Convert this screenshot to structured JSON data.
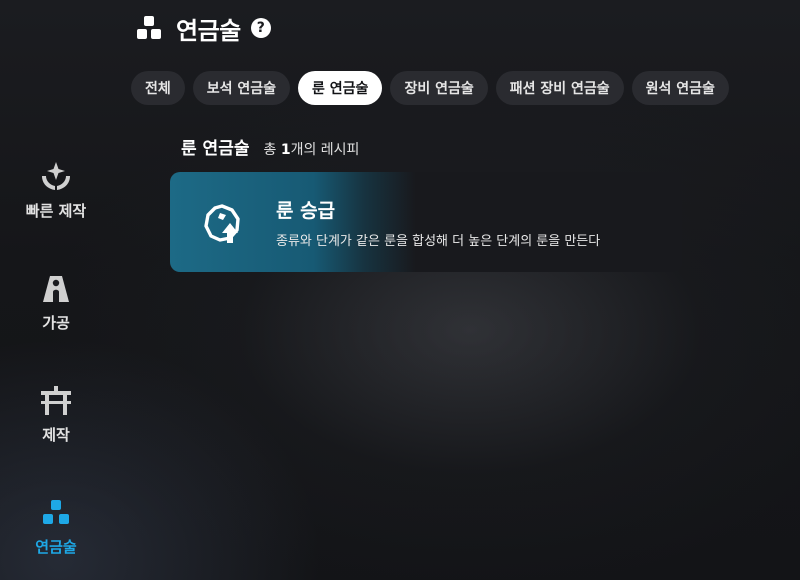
{
  "header": {
    "title": "연금술",
    "help_icon": "question-icon",
    "help_glyph": "?"
  },
  "tabs": [
    {
      "label": "전체",
      "active": false
    },
    {
      "label": "보석 연금술",
      "active": false
    },
    {
      "label": "룬 연금술",
      "active": true
    },
    {
      "label": "장비 연금술",
      "active": false
    },
    {
      "label": "패션 장비 연금술",
      "active": false
    },
    {
      "label": "원석 연금술",
      "active": false
    }
  ],
  "section": {
    "title": "룬 연금술",
    "count_prefix": "총 ",
    "count_value": "1",
    "count_suffix": "개의 레시피"
  },
  "recipes": [
    {
      "title": "룬 승급",
      "description": "종류와 단계가 같은 룬을 합성해 더 높은 단계의 룬을 만든다",
      "icon": "rune-upgrade-icon"
    }
  ],
  "nav": [
    {
      "label": "빠른 제작",
      "icon": "quick-craft-icon",
      "active": false
    },
    {
      "label": "가공",
      "icon": "processing-icon",
      "active": false
    },
    {
      "label": "제작",
      "icon": "crafting-icon",
      "active": false
    },
    {
      "label": "연금술",
      "icon": "alchemy-icon",
      "active": true
    }
  ],
  "colors": {
    "accent": "#1ea8e6",
    "card_gradient_start": "#1d6a86",
    "tab_active_bg": "#ffffff",
    "tab_bg": "#2a2b30"
  }
}
